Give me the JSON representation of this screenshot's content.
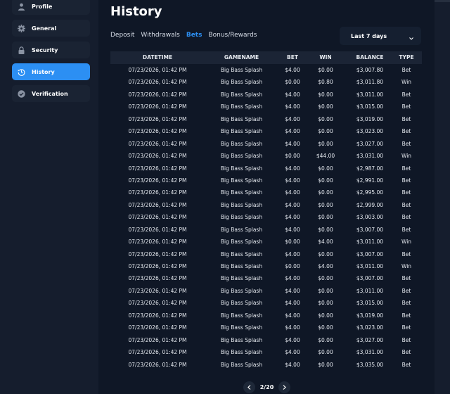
{
  "sidebar": {
    "items": [
      {
        "label": "Profile",
        "icon": "user-icon",
        "active": false
      },
      {
        "label": "General",
        "icon": "gear-icon",
        "active": false
      },
      {
        "label": "Security",
        "icon": "lock-icon",
        "active": false
      },
      {
        "label": "History",
        "icon": "history-icon",
        "active": true
      },
      {
        "label": "Verification",
        "icon": "check-circle-icon",
        "active": false
      }
    ]
  },
  "page": {
    "title": "History"
  },
  "tabs": [
    {
      "label": "Deposit",
      "active": false
    },
    {
      "label": "Withdrawals",
      "active": false
    },
    {
      "label": "Bets",
      "active": true
    },
    {
      "label": "Bonus/Rewards",
      "active": false
    }
  ],
  "filter": {
    "value": "Last 7 days",
    "icon": "chevron-down-icon"
  },
  "table": {
    "headers": [
      "DATETIME",
      "GAMENAME",
      "BET",
      "WIN",
      "BALANCE",
      "TYPE"
    ],
    "rows": [
      [
        "07/23/2026, 01:42 PM",
        "Big Bass Splash",
        "$4.00",
        "$0.00",
        "$3,007.80",
        "Bet"
      ],
      [
        "07/23/2026, 01:42 PM",
        "Big Bass Splash",
        "$0.00",
        "$0.80",
        "$3,011.80",
        "Win"
      ],
      [
        "07/23/2026, 01:42 PM",
        "Big Bass Splash",
        "$4.00",
        "$0.00",
        "$3,011.00",
        "Bet"
      ],
      [
        "07/23/2026, 01:42 PM",
        "Big Bass Splash",
        "$4.00",
        "$0.00",
        "$3,015.00",
        "Bet"
      ],
      [
        "07/23/2026, 01:42 PM",
        "Big Bass Splash",
        "$4.00",
        "$0.00",
        "$3,019.00",
        "Bet"
      ],
      [
        "07/23/2026, 01:42 PM",
        "Big Bass Splash",
        "$4.00",
        "$0.00",
        "$3,023.00",
        "Bet"
      ],
      [
        "07/23/2026, 01:42 PM",
        "Big Bass Splash",
        "$4.00",
        "$0.00",
        "$3,027.00",
        "Bet"
      ],
      [
        "07/23/2026, 01:42 PM",
        "Big Bass Splash",
        "$0.00",
        "$44.00",
        "$3,031.00",
        "Win"
      ],
      [
        "07/23/2026, 01:42 PM",
        "Big Bass Splash",
        "$4.00",
        "$0.00",
        "$2,987.00",
        "Bet"
      ],
      [
        "07/23/2026, 01:42 PM",
        "Big Bass Splash",
        "$4.00",
        "$0.00",
        "$2,991.00",
        "Bet"
      ],
      [
        "07/23/2026, 01:42 PM",
        "Big Bass Splash",
        "$4.00",
        "$0.00",
        "$2,995.00",
        "Bet"
      ],
      [
        "07/23/2026, 01:42 PM",
        "Big Bass Splash",
        "$4.00",
        "$0.00",
        "$2,999.00",
        "Bet"
      ],
      [
        "07/23/2026, 01:42 PM",
        "Big Bass Splash",
        "$4.00",
        "$0.00",
        "$3,003.00",
        "Bet"
      ],
      [
        "07/23/2026, 01:42 PM",
        "Big Bass Splash",
        "$4.00",
        "$0.00",
        "$3,007.00",
        "Bet"
      ],
      [
        "07/23/2026, 01:42 PM",
        "Big Bass Splash",
        "$0.00",
        "$4.00",
        "$3,011.00",
        "Win"
      ],
      [
        "07/23/2026, 01:42 PM",
        "Big Bass Splash",
        "$4.00",
        "$0.00",
        "$3,007.00",
        "Bet"
      ],
      [
        "07/23/2026, 01:42 PM",
        "Big Bass Splash",
        "$0.00",
        "$4.00",
        "$3,011.00",
        "Win"
      ],
      [
        "07/23/2026, 01:42 PM",
        "Big Bass Splash",
        "$4.00",
        "$0.00",
        "$3,007.00",
        "Bet"
      ],
      [
        "07/23/2026, 01:42 PM",
        "Big Bass Splash",
        "$4.00",
        "$0.00",
        "$3,011.00",
        "Bet"
      ],
      [
        "07/23/2026, 01:42 PM",
        "Big Bass Splash",
        "$4.00",
        "$0.00",
        "$3,015.00",
        "Bet"
      ],
      [
        "07/23/2026, 01:42 PM",
        "Big Bass Splash",
        "$4.00",
        "$0.00",
        "$3,019.00",
        "Bet"
      ],
      [
        "07/23/2026, 01:42 PM",
        "Big Bass Splash",
        "$4.00",
        "$0.00",
        "$3,023.00",
        "Bet"
      ],
      [
        "07/23/2026, 01:42 PM",
        "Big Bass Splash",
        "$4.00",
        "$0.00",
        "$3,027.00",
        "Bet"
      ],
      [
        "07/23/2026, 01:42 PM",
        "Big Bass Splash",
        "$4.00",
        "$0.00",
        "$3,031.00",
        "Bet"
      ],
      [
        "07/23/2026, 01:42 PM",
        "Big Bass Splash",
        "$4.00",
        "$0.00",
        "$3,035.00",
        "Bet"
      ]
    ]
  },
  "pagination": {
    "label": "2/20",
    "prev_icon": "chevron-left-icon",
    "next_icon": "chevron-right-icon"
  },
  "colors": {
    "accent": "#2c8ff3",
    "background": "#0f1726",
    "sidebar": "#151d2d"
  }
}
